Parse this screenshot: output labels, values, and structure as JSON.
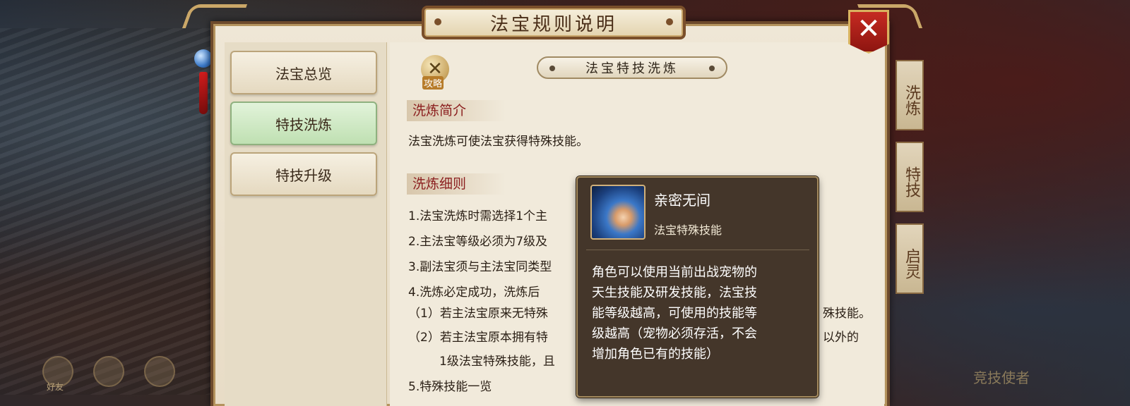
{
  "dialog": {
    "title": "法宝规则说明",
    "close_label": "✕"
  },
  "tabs": [
    {
      "label": "法宝总览",
      "active": false
    },
    {
      "label": "特技洗炼",
      "active": true
    },
    {
      "label": "特技升级",
      "active": false
    }
  ],
  "guide_icon_label": "攻略",
  "section_banner": "法宝特技洗炼",
  "intro": {
    "heading": "洗炼简介",
    "text": "法宝洗炼可使法宝获得特殊技能。"
  },
  "rules": {
    "heading": "洗炼细则",
    "lines": [
      "1.法宝洗炼时需选择1个主",
      "2.主法宝等级必须为7级及",
      "3.副法宝须与主法宝同类型",
      "4.洗炼必定成功，洗炼后",
      "（1）若主法宝原来无特殊",
      "（2）若主法宝原本拥有特",
      "1级法宝特殊技能，且",
      "5.特殊技能一览"
    ],
    "partial_right": [
      "殊技能。",
      "以外的"
    ]
  },
  "tooltip": {
    "skill_name": "亲密无间",
    "skill_type": "法宝特殊技能",
    "description_lines": [
      "角色可以使用当前出战宠物的",
      "天生技能及研发技能，法宝技",
      "能等级越高，可使用的技能等",
      "级越高（宠物必须存活，不会",
      "增加角色已有的技能）"
    ]
  },
  "background": {
    "right_buttons": [
      "洗炼",
      "特技",
      "启灵"
    ],
    "bottom_right_text": "竞技使者",
    "bottom_left_label": "好友"
  },
  "colors": {
    "accent_red": "#8b1e1e",
    "tab_active_green": "#bfe0b2",
    "close_red": "#c52b22",
    "tooltip_bg": "#3e3024"
  }
}
